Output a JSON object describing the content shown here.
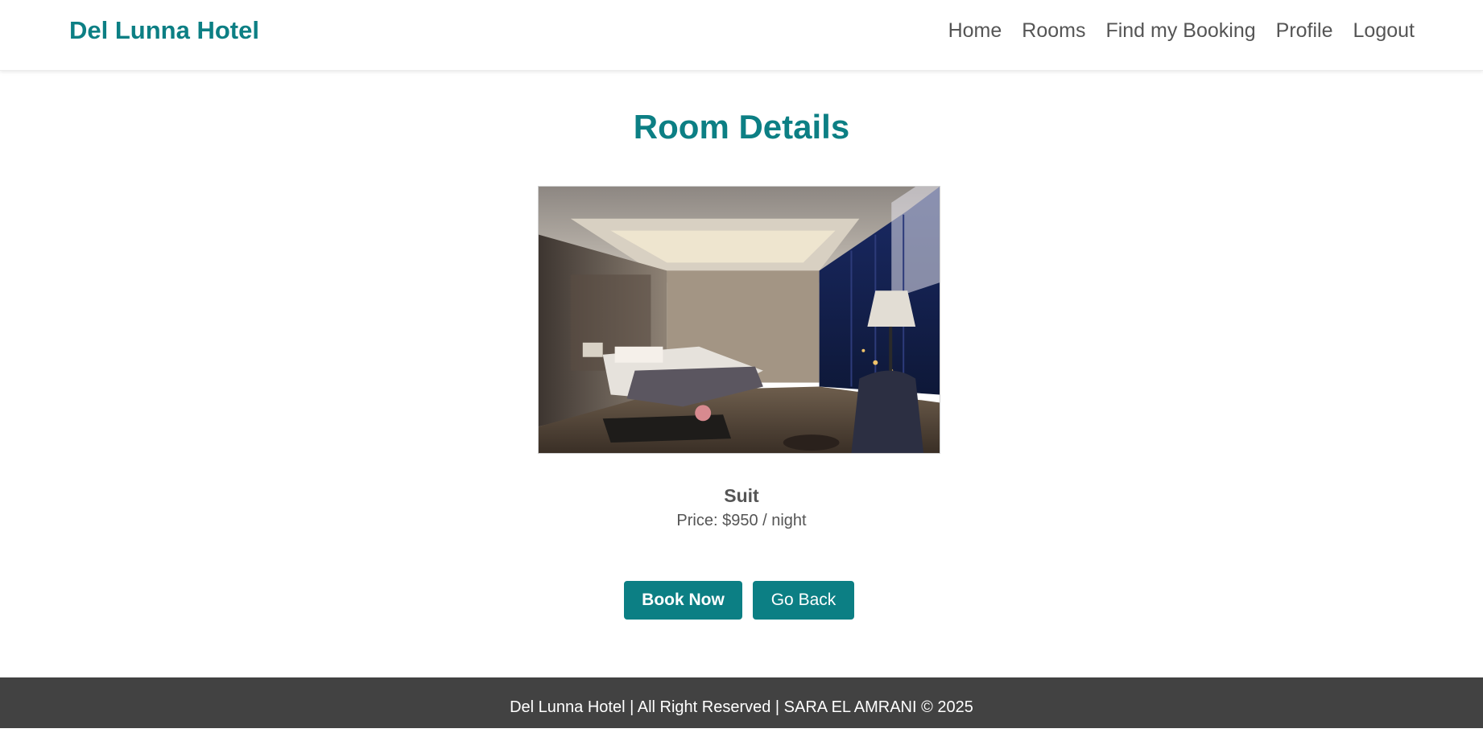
{
  "navbar": {
    "brand": "Del Lunna Hotel",
    "links": [
      "Home",
      "Rooms",
      "Find my Booking",
      "Profile",
      "Logout"
    ]
  },
  "page": {
    "title": "Room Details"
  },
  "room": {
    "image_icon": "room-photo",
    "name": "Suit",
    "price": "Price: $950 / night"
  },
  "actions": {
    "book_label": "Book Now",
    "back_label": "Go Back"
  },
  "footer": {
    "text": "Del Lunna Hotel | All Right Reserved | SARA EL AMRANI © 2025"
  },
  "colors": {
    "accent": "#0c7f84",
    "text_muted": "#555555",
    "footer_bg": "#424242"
  }
}
